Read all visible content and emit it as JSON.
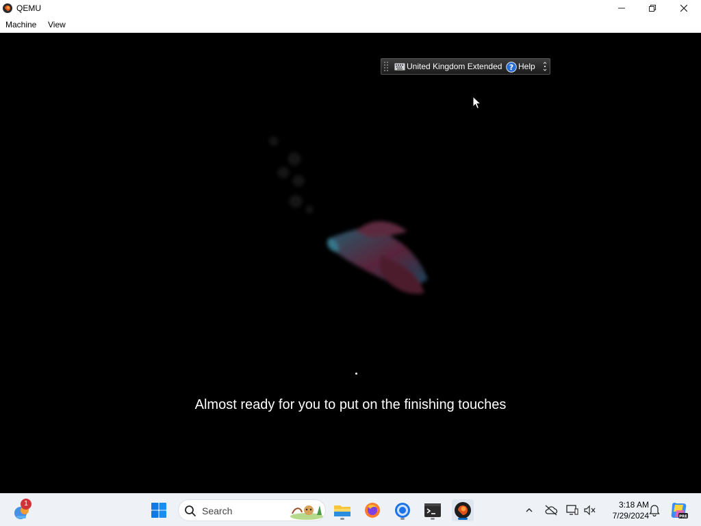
{
  "window": {
    "title": "QEMU",
    "minimize_icon": "minimize-icon",
    "maximize_icon": "restore-icon",
    "close_icon": "close-icon"
  },
  "menubar": {
    "items": [
      "Machine",
      "View"
    ]
  },
  "guest": {
    "language_bar": {
      "layout": "United Kingdom Extended",
      "help": "Help"
    },
    "status_message": "Almost ready for you to put on the finishing touches",
    "background_color": "#000000"
  },
  "taskbar": {
    "widgets_badge": "1",
    "search_placeholder": "Search",
    "apps": [
      "file-explorer",
      "firefox",
      "chrome",
      "terminal",
      "qemu"
    ],
    "clock": {
      "time": "3:18 AM",
      "date": "7/29/2024"
    },
    "accent_color": "#0067c0"
  }
}
